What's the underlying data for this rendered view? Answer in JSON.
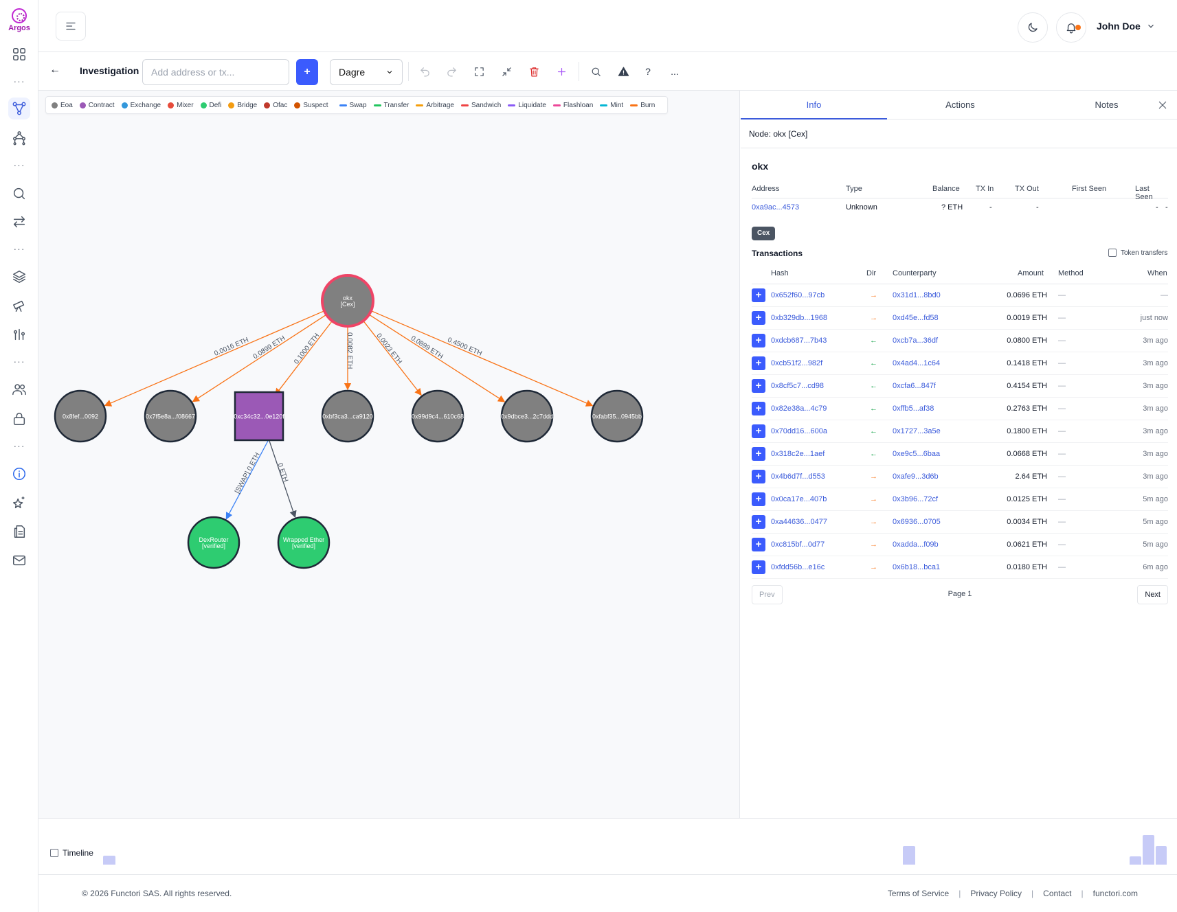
{
  "brand": {
    "name": "Argos"
  },
  "user": {
    "name": "John Doe"
  },
  "toolbar": {
    "back": "←",
    "title": "Investigation",
    "input_placeholder": "Add address or tx...",
    "add_label": "+",
    "layout_value": "Dagre",
    "help": "?",
    "more": "..."
  },
  "legend": {
    "nodes": [
      {
        "label": "Eoa",
        "color": "#808080"
      },
      {
        "label": "Contract",
        "color": "#9b59b6"
      },
      {
        "label": "Exchange",
        "color": "#3498db"
      },
      {
        "label": "Mixer",
        "color": "#e74c3c"
      },
      {
        "label": "Defi",
        "color": "#2ecc71"
      },
      {
        "label": "Bridge",
        "color": "#f39c12"
      },
      {
        "label": "Ofac",
        "color": "#c0392b"
      },
      {
        "label": "Suspect",
        "color": "#d35400"
      }
    ],
    "edges": [
      {
        "label": "Swap",
        "color": "#3b82f6"
      },
      {
        "label": "Transfer",
        "color": "#22c55e"
      },
      {
        "label": "Arbitrage",
        "color": "#f59e0b"
      },
      {
        "label": "Sandwich",
        "color": "#ef4444"
      },
      {
        "label": "Liquidate",
        "color": "#8b5cf6"
      },
      {
        "label": "Flashloan",
        "color": "#ec4899"
      },
      {
        "label": "Mint",
        "color": "#06b6d4"
      },
      {
        "label": "Burn",
        "color": "#f97316"
      }
    ]
  },
  "graph": {
    "root": {
      "line1": "okx",
      "line2": "[Cex]"
    },
    "children": [
      {
        "label": "0x8fef...0092",
        "edge": "0.0016 ETH",
        "shape": "circle"
      },
      {
        "label": "0x7f5e8a...f08667",
        "edge": "0.0899 ETH",
        "shape": "circle"
      },
      {
        "label": "0xc34c32...0e120f",
        "edge": "0.1000 ETH",
        "shape": "square"
      },
      {
        "label": "0xbf3ca3...ca9120",
        "edge": "0.0082 ETH",
        "shape": "circle"
      },
      {
        "label": "0x99d9c4...610c68",
        "edge": "0.0023 ETH",
        "shape": "circle"
      },
      {
        "label": "0x9dbce3...2c7ddd",
        "edge": "0.0899 ETH",
        "shape": "circle"
      },
      {
        "label": "0xfabf35...0945bb",
        "edge": "0.4500 ETH",
        "shape": "circle"
      }
    ],
    "grandchildren": [
      {
        "line1": "DexRouter",
        "line2": "[verified]",
        "edge": "[SWAP] 0 ETH"
      },
      {
        "line1": "Wrapped Ether",
        "line2": "[verified]",
        "edge": "0 ETH"
      }
    ]
  },
  "panel": {
    "tabs": [
      "Info",
      "Actions",
      "Notes"
    ],
    "node_label": "Node:",
    "node_value": "okx [Cex]",
    "name": "okx",
    "summary_headers": [
      "Address",
      "Type",
      "Balance",
      "TX In",
      "TX Out",
      "First Seen",
      "Last Seen"
    ],
    "summary": {
      "address": "0xa9ac...4573",
      "type": "Unknown",
      "balance": "? ETH",
      "tx_in": "-",
      "tx_out": "-",
      "first_seen": "-",
      "last_seen": "-"
    },
    "badge": "Cex",
    "tx_title": "Transactions",
    "token_transfers": "Token transfers",
    "tx_headers": [
      "Hash",
      "Dir",
      "Counterparty",
      "Amount",
      "Method",
      "When"
    ],
    "transactions": [
      {
        "hash": "0x652f60...97cb",
        "dir": "out",
        "counterparty": "0x31d1...8bd0",
        "amount": "0.0696 ETH",
        "method": "—",
        "when": "—"
      },
      {
        "hash": "0xb329db...1968",
        "dir": "out",
        "counterparty": "0xd45e...fd58",
        "amount": "0.0019 ETH",
        "method": "—",
        "when": "just now"
      },
      {
        "hash": "0xdcb687...7b43",
        "dir": "in",
        "counterparty": "0xcb7a...36df",
        "amount": "0.0800 ETH",
        "method": "—",
        "when": "3m ago"
      },
      {
        "hash": "0xcb51f2...982f",
        "dir": "in",
        "counterparty": "0x4ad4...1c64",
        "amount": "0.1418 ETH",
        "method": "—",
        "when": "3m ago"
      },
      {
        "hash": "0x8cf5c7...cd98",
        "dir": "in",
        "counterparty": "0xcfa6...847f",
        "amount": "0.4154 ETH",
        "method": "—",
        "when": "3m ago"
      },
      {
        "hash": "0x82e38a...4c79",
        "dir": "in",
        "counterparty": "0xffb5...af38",
        "amount": "0.2763 ETH",
        "method": "—",
        "when": "3m ago"
      },
      {
        "hash": "0x70dd16...600a",
        "dir": "in",
        "counterparty": "0x1727...3a5e",
        "amount": "0.1800 ETH",
        "method": "—",
        "when": "3m ago"
      },
      {
        "hash": "0x318c2e...1aef",
        "dir": "in",
        "counterparty": "0xe9c5...6baa",
        "amount": "0.0668 ETH",
        "method": "—",
        "when": "3m ago"
      },
      {
        "hash": "0x4b6d7f...d553",
        "dir": "out",
        "counterparty": "0xafe9...3d6b",
        "amount": "2.64 ETH",
        "method": "—",
        "when": "3m ago"
      },
      {
        "hash": "0x0ca17e...407b",
        "dir": "out",
        "counterparty": "0x3b96...72cf",
        "amount": "0.0125 ETH",
        "method": "—",
        "when": "5m ago"
      },
      {
        "hash": "0xa44636...0477",
        "dir": "out",
        "counterparty": "0x6936...0705",
        "amount": "0.0034 ETH",
        "method": "—",
        "when": "5m ago"
      },
      {
        "hash": "0xc815bf...0d77",
        "dir": "out",
        "counterparty": "0xadda...f09b",
        "amount": "0.0621 ETH",
        "method": "—",
        "when": "5m ago"
      },
      {
        "hash": "0xfdd56b...e16c",
        "dir": "out",
        "counterparty": "0x6b18...bca1",
        "amount": "0.0180 ETH",
        "method": "—",
        "when": "6m ago"
      }
    ],
    "prev": "Prev",
    "next": "Next",
    "page": "Page 1"
  },
  "timeline": {
    "label": "Timeline"
  },
  "footer": {
    "copyright": "© 2026 Functori SAS. All rights reserved.",
    "links": [
      "Terms of Service",
      "Privacy Policy",
      "Contact",
      "functori.com"
    ]
  }
}
